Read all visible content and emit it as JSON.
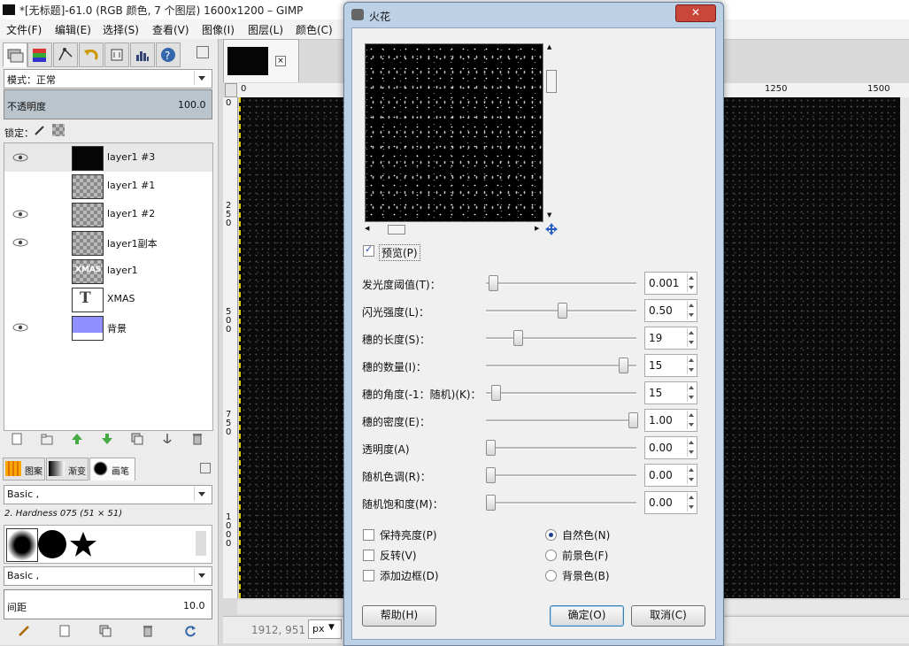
{
  "window": {
    "title": "*[无标题]-61.0 (RGB 颜色, 7 个图层) 1600x1200 – GIMP"
  },
  "menu": [
    "文件(F)",
    "编辑(E)",
    "选择(S)",
    "查看(V)",
    "图像(I)",
    "图层(L)",
    "颜色(C)"
  ],
  "layers_panel": {
    "mode_label": "模式：",
    "mode_value": "正常",
    "opacity_label": "不透明度",
    "opacity_value": "100.0",
    "lock_label": "锁定：",
    "layers": [
      {
        "name": "layer1 #3",
        "visible": true,
        "selected": true
      },
      {
        "name": "layer1 #1",
        "visible": false
      },
      {
        "name": "layer1 #2",
        "visible": true
      },
      {
        "name": "layer1副本",
        "visible": true
      },
      {
        "name": "layer1",
        "visible": false
      },
      {
        "name": "XMAS",
        "visible": false
      },
      {
        "name": "背景",
        "visible": true
      }
    ],
    "thumb_text_xmas": "XMAS",
    "thumb_text_t": "T"
  },
  "brushes_panel": {
    "tabs": [
      "图案",
      "渐变",
      "画笔"
    ],
    "filter": "Basic ,",
    "current_brush": "2. Hardness 075 (51 × 51)",
    "filter2": "Basic ,",
    "spacing_label": "间距",
    "spacing_value": "10.0"
  },
  "ruler": {
    "h_marks": [
      "0",
      "1250",
      "1500"
    ],
    "v_marks": [
      "0",
      "250",
      "500",
      "750",
      "1000"
    ]
  },
  "status": {
    "coords": "1912, 951",
    "unit": "px"
  },
  "dialog": {
    "title": "火花",
    "close": "✕",
    "preview_label": "预览(P)",
    "preview_checked": true,
    "params": [
      {
        "label": "发光度阈值(T)：",
        "value": "0.001",
        "fraction": 0.02
      },
      {
        "label": "闪光强度(L)：",
        "value": "0.50",
        "fraction": 0.5
      },
      {
        "label": "穗的长度(S)：",
        "value": "19",
        "fraction": 0.19
      },
      {
        "label": "穗的数量(I)：",
        "value": "15",
        "fraction": 0.93
      },
      {
        "label": "穗的角度(-1：随机)(K)：",
        "value": "15",
        "fraction": 0.04
      },
      {
        "label": "穗的密度(E)：",
        "value": "1.00",
        "fraction": 1.0
      },
      {
        "label": "透明度(A)",
        "value": "0.00",
        "fraction": 0.0
      },
      {
        "label": "随机色调(R)：",
        "value": "0.00",
        "fraction": 0.0
      },
      {
        "label": "随机饱和度(M)：",
        "value": "0.00",
        "fraction": 0.0
      }
    ],
    "checks": [
      {
        "label": "保持亮度(P)",
        "checked": false
      },
      {
        "label": "反转(V)",
        "checked": false
      },
      {
        "label": "添加边框(D)",
        "checked": false
      }
    ],
    "radios": [
      {
        "label": "自然色(N)",
        "selected": true
      },
      {
        "label": "前景色(F)",
        "selected": false
      },
      {
        "label": "背景色(B)",
        "selected": false
      }
    ],
    "buttons": {
      "help": "帮助(H)",
      "ok": "确定(O)",
      "cancel": "取消(C)"
    }
  }
}
